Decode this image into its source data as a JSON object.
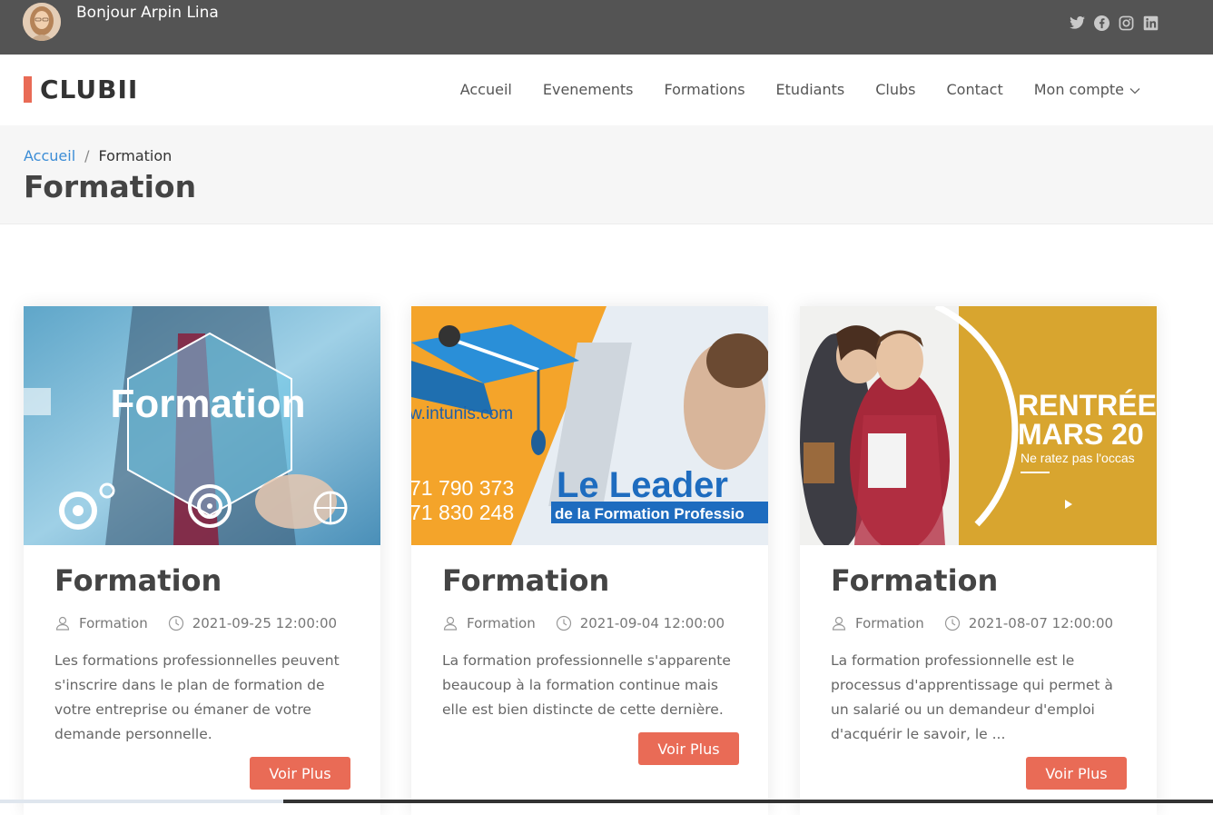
{
  "topbar": {
    "greeting": "Bonjour Arpin Lina",
    "socials": [
      "twitter-icon",
      "facebook-icon",
      "instagram-icon",
      "linkedin-icon"
    ]
  },
  "header": {
    "logo": "CLUBII",
    "nav": [
      "Accueil",
      "Evenements",
      "Formations",
      "Etudiants",
      "Clubs",
      "Contact",
      "Mon compte"
    ]
  },
  "breadcrumb": {
    "home": "Accueil",
    "separator": "/",
    "current": "Formation"
  },
  "page": {
    "title": "Formation"
  },
  "cards": [
    {
      "title": "Formation",
      "category": "Formation",
      "date": "2021-09-25 12:00:00",
      "description": "Les formations professionnelles peuvent s'inscrire dans le plan de formation de votre entreprise ou émaner de votre demande personnelle.",
      "button": "Voir Plus",
      "image_text": "Formation"
    },
    {
      "title": "Formation",
      "category": "Formation",
      "date": "2021-09-04 12:00:00",
      "description": "La formation professionnelle s'apparente beaucoup à la formation continue mais elle est bien distincte de cette dernière.",
      "button": "Voir Plus",
      "image_url_text": "w.intunis.com",
      "image_phone1": "71 790 373",
      "image_phone2": "71 830 248",
      "image_leader": "Le Leader",
      "image_sub": "de la Formation Professio"
    },
    {
      "title": "Formation",
      "category": "Formation",
      "date": "2021-08-07 12:00:00",
      "description": "La formation professionnelle est le processus d'apprentissage qui permet à un salarié ou un demandeur d'emploi d'acquérir le savoir, le ...",
      "button": "Voir Plus",
      "image_line1": "RENTRÉE",
      "image_line2": "MARS 20",
      "image_line3": "Ne ratez pas l'occas"
    }
  ],
  "colors": {
    "topbar": "#545454",
    "accent": "#e96b56",
    "link": "#3c8dd6"
  }
}
